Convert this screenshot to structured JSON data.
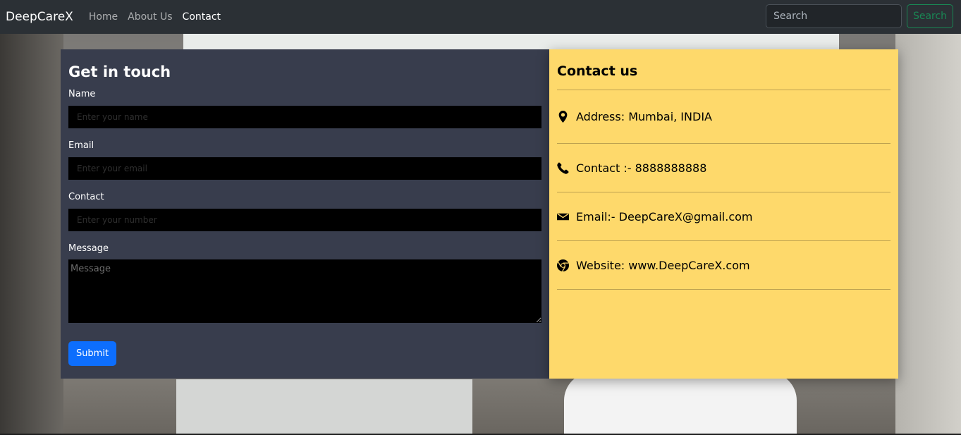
{
  "nav": {
    "brand": "DeepCareX",
    "links": [
      "Home",
      "About Us",
      "Contact"
    ],
    "search_placeholder": "Search",
    "search_button": "Search"
  },
  "form": {
    "title": "Get in touch",
    "fields": [
      {
        "label": "Name",
        "placeholder": "Enter your name",
        "value": ""
      },
      {
        "label": "Email",
        "placeholder": "Enter your email",
        "value": ""
      },
      {
        "label": "Contact",
        "placeholder": "Enter your number",
        "value": ""
      },
      {
        "label": "Message",
        "placeholder": "Message",
        "value": ""
      }
    ],
    "submit_label": "Submit"
  },
  "contact": {
    "title": "Contact us",
    "items": [
      {
        "icon": "location-pin-icon",
        "text": "Address: Mumbai, INDIA"
      },
      {
        "icon": "phone-icon",
        "text": "Contact :- 8888888888"
      },
      {
        "icon": "envelope-icon",
        "text": "Email:- DeepCareX@gmail.com"
      },
      {
        "icon": "chrome-icon",
        "text": "Website: www.DeepCareX.com"
      }
    ]
  },
  "colors": {
    "navbar": "#2b3035",
    "form_panel": "#383d4d",
    "contact_panel": "#fed96b",
    "submit": "#0d6efd",
    "search_outline": "#198754"
  }
}
